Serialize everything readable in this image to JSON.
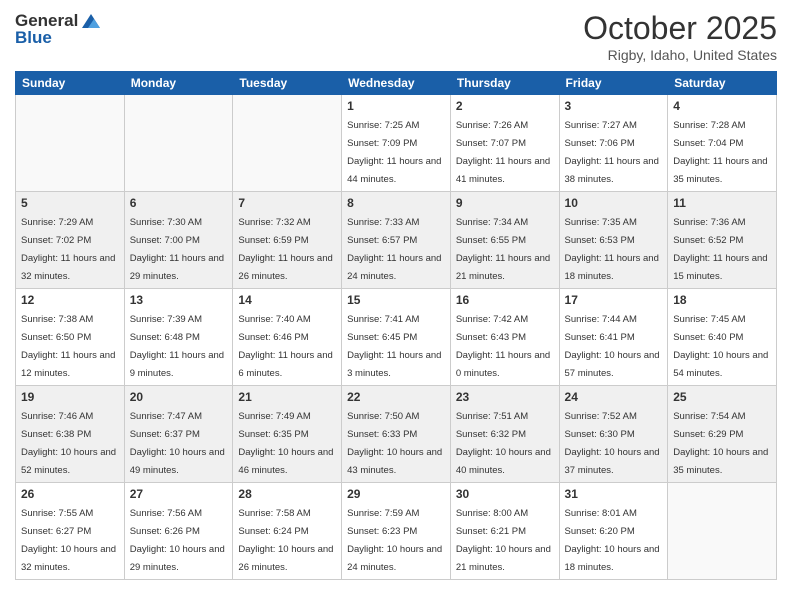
{
  "logo": {
    "general": "General",
    "blue": "Blue"
  },
  "header": {
    "month": "October 2025",
    "location": "Rigby, Idaho, United States"
  },
  "weekdays": [
    "Sunday",
    "Monday",
    "Tuesday",
    "Wednesday",
    "Thursday",
    "Friday",
    "Saturday"
  ],
  "weeks": [
    [
      {
        "day": "",
        "sunrise": "",
        "sunset": "",
        "daylight": ""
      },
      {
        "day": "",
        "sunrise": "",
        "sunset": "",
        "daylight": ""
      },
      {
        "day": "",
        "sunrise": "",
        "sunset": "",
        "daylight": ""
      },
      {
        "day": "1",
        "sunrise": "Sunrise: 7:25 AM",
        "sunset": "Sunset: 7:09 PM",
        "daylight": "Daylight: 11 hours and 44 minutes."
      },
      {
        "day": "2",
        "sunrise": "Sunrise: 7:26 AM",
        "sunset": "Sunset: 7:07 PM",
        "daylight": "Daylight: 11 hours and 41 minutes."
      },
      {
        "day": "3",
        "sunrise": "Sunrise: 7:27 AM",
        "sunset": "Sunset: 7:06 PM",
        "daylight": "Daylight: 11 hours and 38 minutes."
      },
      {
        "day": "4",
        "sunrise": "Sunrise: 7:28 AM",
        "sunset": "Sunset: 7:04 PM",
        "daylight": "Daylight: 11 hours and 35 minutes."
      }
    ],
    [
      {
        "day": "5",
        "sunrise": "Sunrise: 7:29 AM",
        "sunset": "Sunset: 7:02 PM",
        "daylight": "Daylight: 11 hours and 32 minutes."
      },
      {
        "day": "6",
        "sunrise": "Sunrise: 7:30 AM",
        "sunset": "Sunset: 7:00 PM",
        "daylight": "Daylight: 11 hours and 29 minutes."
      },
      {
        "day": "7",
        "sunrise": "Sunrise: 7:32 AM",
        "sunset": "Sunset: 6:59 PM",
        "daylight": "Daylight: 11 hours and 26 minutes."
      },
      {
        "day": "8",
        "sunrise": "Sunrise: 7:33 AM",
        "sunset": "Sunset: 6:57 PM",
        "daylight": "Daylight: 11 hours and 24 minutes."
      },
      {
        "day": "9",
        "sunrise": "Sunrise: 7:34 AM",
        "sunset": "Sunset: 6:55 PM",
        "daylight": "Daylight: 11 hours and 21 minutes."
      },
      {
        "day": "10",
        "sunrise": "Sunrise: 7:35 AM",
        "sunset": "Sunset: 6:53 PM",
        "daylight": "Daylight: 11 hours and 18 minutes."
      },
      {
        "day": "11",
        "sunrise": "Sunrise: 7:36 AM",
        "sunset": "Sunset: 6:52 PM",
        "daylight": "Daylight: 11 hours and 15 minutes."
      }
    ],
    [
      {
        "day": "12",
        "sunrise": "Sunrise: 7:38 AM",
        "sunset": "Sunset: 6:50 PM",
        "daylight": "Daylight: 11 hours and 12 minutes."
      },
      {
        "day": "13",
        "sunrise": "Sunrise: 7:39 AM",
        "sunset": "Sunset: 6:48 PM",
        "daylight": "Daylight: 11 hours and 9 minutes."
      },
      {
        "day": "14",
        "sunrise": "Sunrise: 7:40 AM",
        "sunset": "Sunset: 6:46 PM",
        "daylight": "Daylight: 11 hours and 6 minutes."
      },
      {
        "day": "15",
        "sunrise": "Sunrise: 7:41 AM",
        "sunset": "Sunset: 6:45 PM",
        "daylight": "Daylight: 11 hours and 3 minutes."
      },
      {
        "day": "16",
        "sunrise": "Sunrise: 7:42 AM",
        "sunset": "Sunset: 6:43 PM",
        "daylight": "Daylight: 11 hours and 0 minutes."
      },
      {
        "day": "17",
        "sunrise": "Sunrise: 7:44 AM",
        "sunset": "Sunset: 6:41 PM",
        "daylight": "Daylight: 10 hours and 57 minutes."
      },
      {
        "day": "18",
        "sunrise": "Sunrise: 7:45 AM",
        "sunset": "Sunset: 6:40 PM",
        "daylight": "Daylight: 10 hours and 54 minutes."
      }
    ],
    [
      {
        "day": "19",
        "sunrise": "Sunrise: 7:46 AM",
        "sunset": "Sunset: 6:38 PM",
        "daylight": "Daylight: 10 hours and 52 minutes."
      },
      {
        "day": "20",
        "sunrise": "Sunrise: 7:47 AM",
        "sunset": "Sunset: 6:37 PM",
        "daylight": "Daylight: 10 hours and 49 minutes."
      },
      {
        "day": "21",
        "sunrise": "Sunrise: 7:49 AM",
        "sunset": "Sunset: 6:35 PM",
        "daylight": "Daylight: 10 hours and 46 minutes."
      },
      {
        "day": "22",
        "sunrise": "Sunrise: 7:50 AM",
        "sunset": "Sunset: 6:33 PM",
        "daylight": "Daylight: 10 hours and 43 minutes."
      },
      {
        "day": "23",
        "sunrise": "Sunrise: 7:51 AM",
        "sunset": "Sunset: 6:32 PM",
        "daylight": "Daylight: 10 hours and 40 minutes."
      },
      {
        "day": "24",
        "sunrise": "Sunrise: 7:52 AM",
        "sunset": "Sunset: 6:30 PM",
        "daylight": "Daylight: 10 hours and 37 minutes."
      },
      {
        "day": "25",
        "sunrise": "Sunrise: 7:54 AM",
        "sunset": "Sunset: 6:29 PM",
        "daylight": "Daylight: 10 hours and 35 minutes."
      }
    ],
    [
      {
        "day": "26",
        "sunrise": "Sunrise: 7:55 AM",
        "sunset": "Sunset: 6:27 PM",
        "daylight": "Daylight: 10 hours and 32 minutes."
      },
      {
        "day": "27",
        "sunrise": "Sunrise: 7:56 AM",
        "sunset": "Sunset: 6:26 PM",
        "daylight": "Daylight: 10 hours and 29 minutes."
      },
      {
        "day": "28",
        "sunrise": "Sunrise: 7:58 AM",
        "sunset": "Sunset: 6:24 PM",
        "daylight": "Daylight: 10 hours and 26 minutes."
      },
      {
        "day": "29",
        "sunrise": "Sunrise: 7:59 AM",
        "sunset": "Sunset: 6:23 PM",
        "daylight": "Daylight: 10 hours and 24 minutes."
      },
      {
        "day": "30",
        "sunrise": "Sunrise: 8:00 AM",
        "sunset": "Sunset: 6:21 PM",
        "daylight": "Daylight: 10 hours and 21 minutes."
      },
      {
        "day": "31",
        "sunrise": "Sunrise: 8:01 AM",
        "sunset": "Sunset: 6:20 PM",
        "daylight": "Daylight: 10 hours and 18 minutes."
      },
      {
        "day": "",
        "sunrise": "",
        "sunset": "",
        "daylight": ""
      }
    ]
  ]
}
